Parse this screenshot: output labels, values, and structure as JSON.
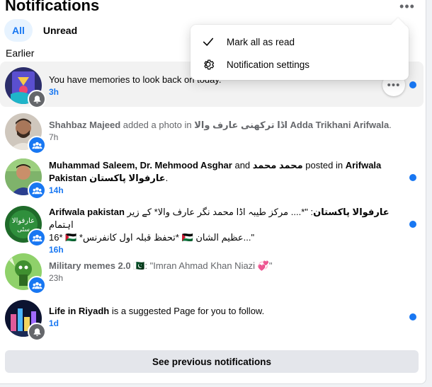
{
  "header": {
    "title": "Notifications",
    "more_label": "•••"
  },
  "tabs": [
    {
      "label": "All",
      "active": true
    },
    {
      "label": "Unread",
      "active": false
    }
  ],
  "section": {
    "label": "Earlier"
  },
  "dropdown": {
    "items": [
      {
        "label": "Mark all as read",
        "icon": "check-icon"
      },
      {
        "label": "Notification settings",
        "icon": "gear-icon"
      }
    ]
  },
  "notifications": [
    {
      "parts": [
        "You have memories to look back on today."
      ],
      "time": "3h",
      "unread": true,
      "badge": "bell-icon",
      "badge_color": "#65676b"
    },
    {
      "actor": "Shahbaz Majeed",
      "middle": " added a photo in ",
      "group": "اڈا ترکھنی عارف والا Adda Trikhani Arifwala",
      "end": ".",
      "time": "7h",
      "unread": false,
      "badge": "group-icon",
      "badge_color": "#1877f2"
    },
    {
      "actor": "Muhammad Saleem, Dr. Mehmood Asghar",
      "middle": " and ",
      "actor2": "محمد محمد",
      "middle2": " posted in ",
      "group": "Arifwala Pakistan عارفوالا پاکستان",
      "end": ".",
      "time": "14h",
      "unread": true,
      "badge": "group-icon",
      "badge_color": "#1877f2"
    },
    {
      "actor": "Arifwala pakistan عارفوالا پاکستان",
      "line1": ": \"*.... مرکز طیبہ اڈا محمد نگر عارف والا* کے زیر اہتمام",
      "line2": "16* 🇵🇸 *تحفظ قبلہ اول کانفرنس* 🇵🇸 عظیم الشان...\"",
      "time": "16h",
      "unread": true,
      "badge": "group-icon",
      "badge_color": "#1877f2"
    },
    {
      "actor": "Military memes 2.0",
      "flag": "🇵🇰",
      "quote": ": \"Imran Ahmad Khan Niazi 💞\"",
      "time": "23h",
      "unread": false,
      "badge": "group-icon",
      "badge_color": "#1877f2"
    },
    {
      "actor": "Life in Riyadh",
      "middle": " is a suggested Page for you to follow.",
      "time": "1d",
      "unread": true,
      "badge": "bell-icon",
      "badge_color": "#65676b"
    }
  ],
  "footer": {
    "see_previous_label": "See previous notifications"
  },
  "colors": {
    "accent": "#1877f2",
    "tab_active_bg": "#e7f3ff",
    "button_bg": "#e4e6eb"
  }
}
